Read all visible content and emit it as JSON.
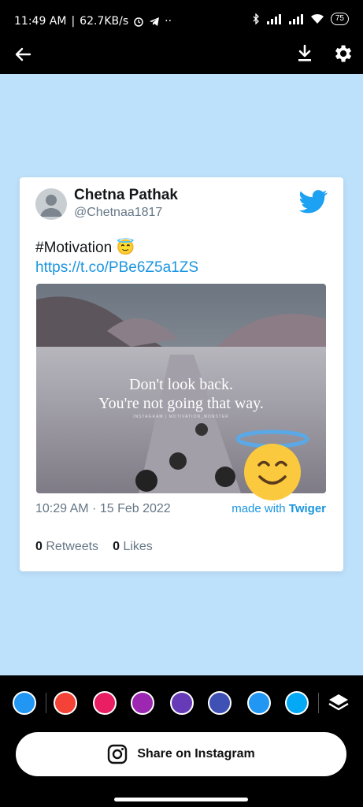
{
  "status_bar": {
    "time": "11:49 AM",
    "net_speed": "62.7KB/s",
    "battery": "75"
  },
  "tweet": {
    "name": "Chetna Pathak",
    "handle": "@Chetnaa1817",
    "text": "#Motivation 😇",
    "link": "https://t.co/PBe6Z5a1ZS",
    "image_line1": "Don't look back.",
    "image_line2": "You're not going that way.",
    "image_credit": "INSTAGRAM | MOTIVATION_MONSTER",
    "time": "10:29 AM · 15 Feb 2022",
    "made_with_prefix": "made with",
    "made_with_brand": "Twiger",
    "retweets_count": "0",
    "retweets_label": "Retweets",
    "likes_count": "0",
    "likes_label": "Likes"
  },
  "palette": {
    "colors": [
      "#2196f3",
      "#f44336",
      "#e91e63",
      "#9c27b0",
      "#673ab7",
      "#3f51b5",
      "#2196f3",
      "#03a9f4"
    ],
    "selected_index": 0
  },
  "share_button": {
    "label": "Share on Instagram"
  },
  "colors": {
    "canvas_bg": "#bde0fb",
    "twitter_blue": "#1da1f2",
    "link": "#1b95e0"
  }
}
